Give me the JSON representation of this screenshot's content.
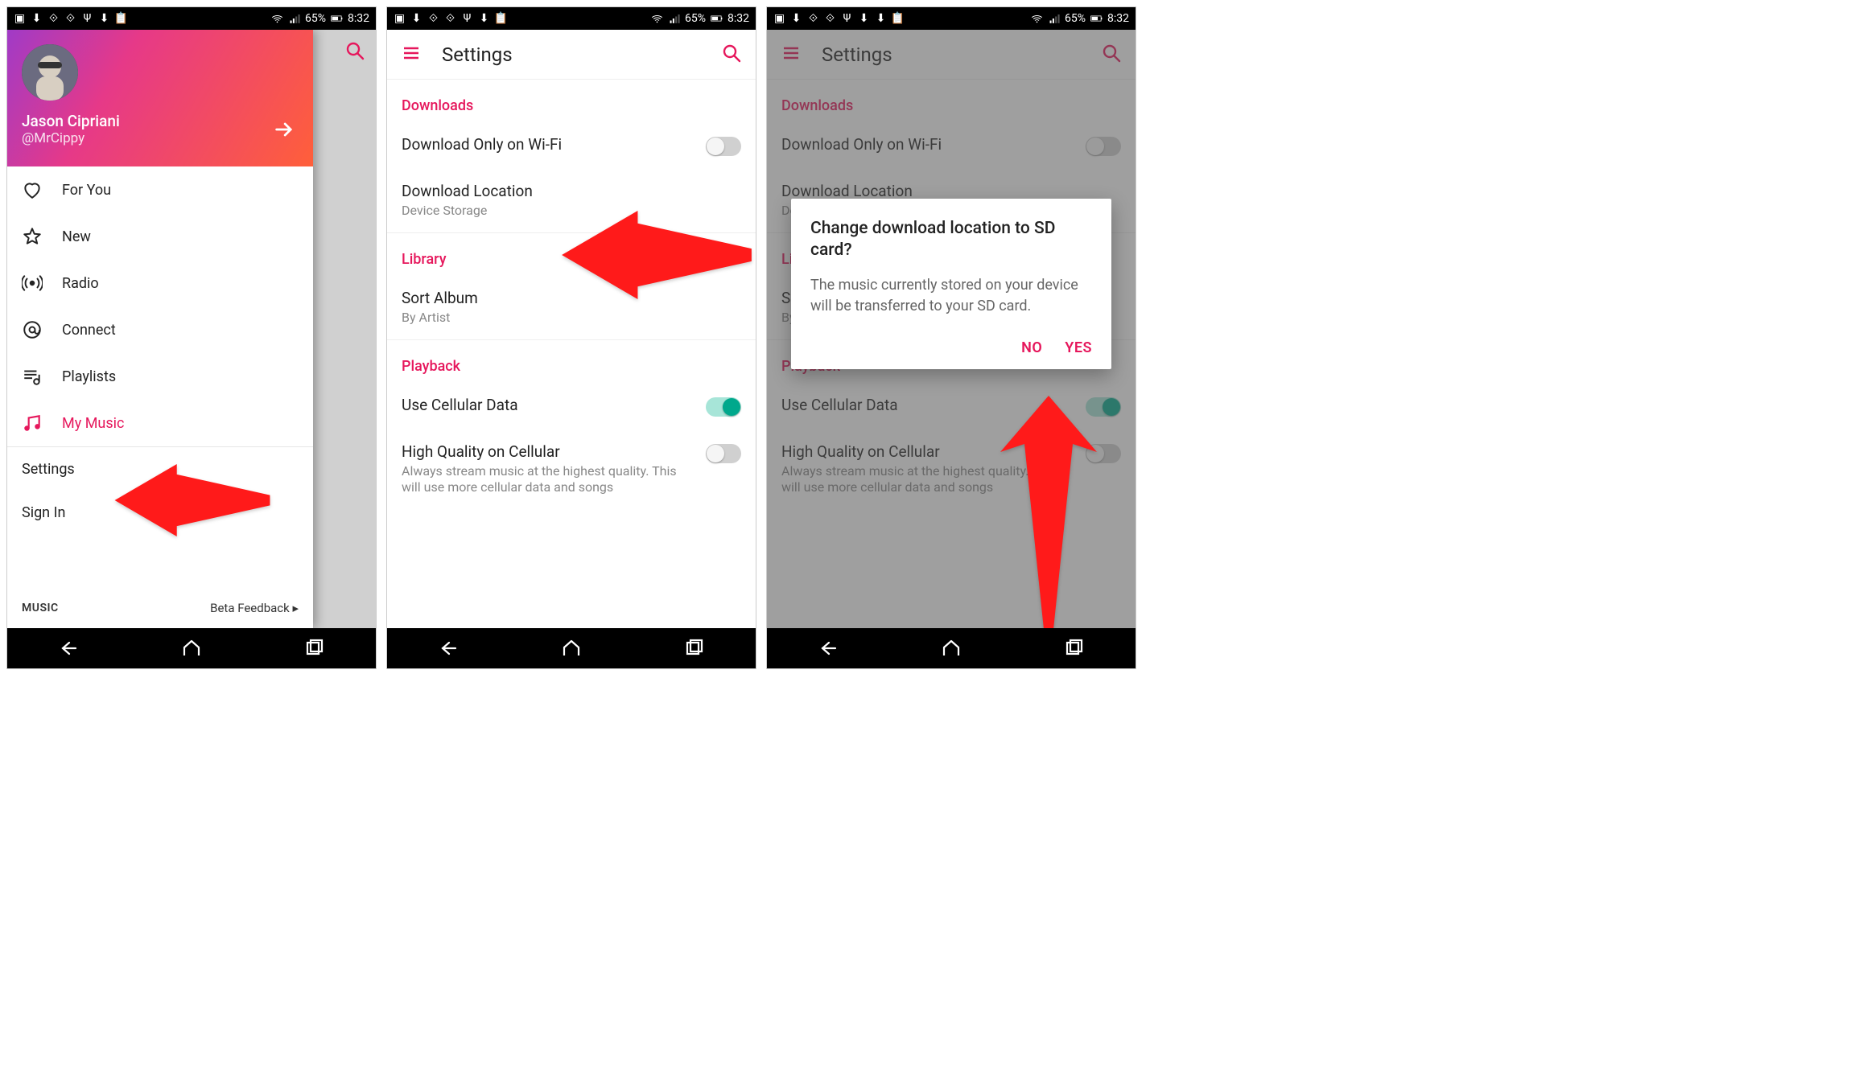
{
  "status": {
    "battery": "65%",
    "time": "8:32"
  },
  "phone1": {
    "user_name": "Jason Cipriani",
    "user_handle": "@MrCippy",
    "items": [
      {
        "label": "For You"
      },
      {
        "label": "New"
      },
      {
        "label": "Radio"
      },
      {
        "label": "Connect"
      },
      {
        "label": "Playlists"
      },
      {
        "label": "My Music"
      }
    ],
    "settings": "Settings",
    "signin": "Sign In",
    "brand": " MUSIC",
    "beta": "Beta Feedback ▸"
  },
  "phone2": {
    "title": "Settings",
    "sections": {
      "downloads": "Downloads",
      "library": "Library",
      "playback": "Playback"
    },
    "wifi": "Download Only on Wi-Fi",
    "dl_loc": "Download Location",
    "dl_loc_sub": "Device Storage",
    "sort": "Sort Album",
    "sort_sub": "By Artist",
    "cell": "Use Cellular Data",
    "hq": "High Quality on Cellular",
    "hq_sub": "Always stream music at the highest quality. This will use more cellular data and songs"
  },
  "dialog": {
    "title": "Change download location to SD card?",
    "body": "The music currently stored on your device will be transferred to your SD card.",
    "no": "NO",
    "yes": "YES"
  }
}
